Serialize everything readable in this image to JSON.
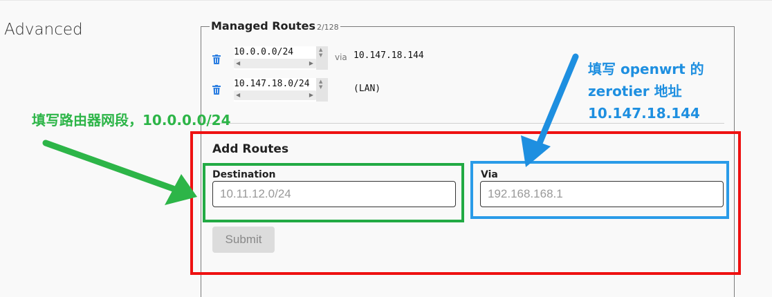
{
  "section_title": "Advanced",
  "managed_routes": {
    "title": "Managed Routes",
    "count": "2/128",
    "routes": [
      {
        "target": "10.0.0.0/24",
        "via_label": "via",
        "via": "10.147.18.144"
      },
      {
        "target": "10.147.18.0/24",
        "via_label": "",
        "via": "(LAN)"
      }
    ]
  },
  "add_routes": {
    "title": "Add Routes",
    "destination_label": "Destination",
    "destination_placeholder": "10.11.12.0/24",
    "via_label": "Via",
    "via_placeholder": "192.168.168.1",
    "submit_label": "Submit"
  },
  "annotations": {
    "green_note": "填写路由器网段，10.0.0.0/24",
    "blue_note_lines": [
      "填写 openwrt 的",
      "zerotier 地址",
      "10.147.18.144"
    ]
  },
  "icons": {
    "delete": "trash-icon",
    "spinner": "up-down-arrow-icon",
    "scroll": "left-right-arrow-icon"
  },
  "colors": {
    "red_box": "#ee1111",
    "green_box": "#22aa44",
    "blue_box": "#2a9be8",
    "trash": "#2a7de1"
  }
}
